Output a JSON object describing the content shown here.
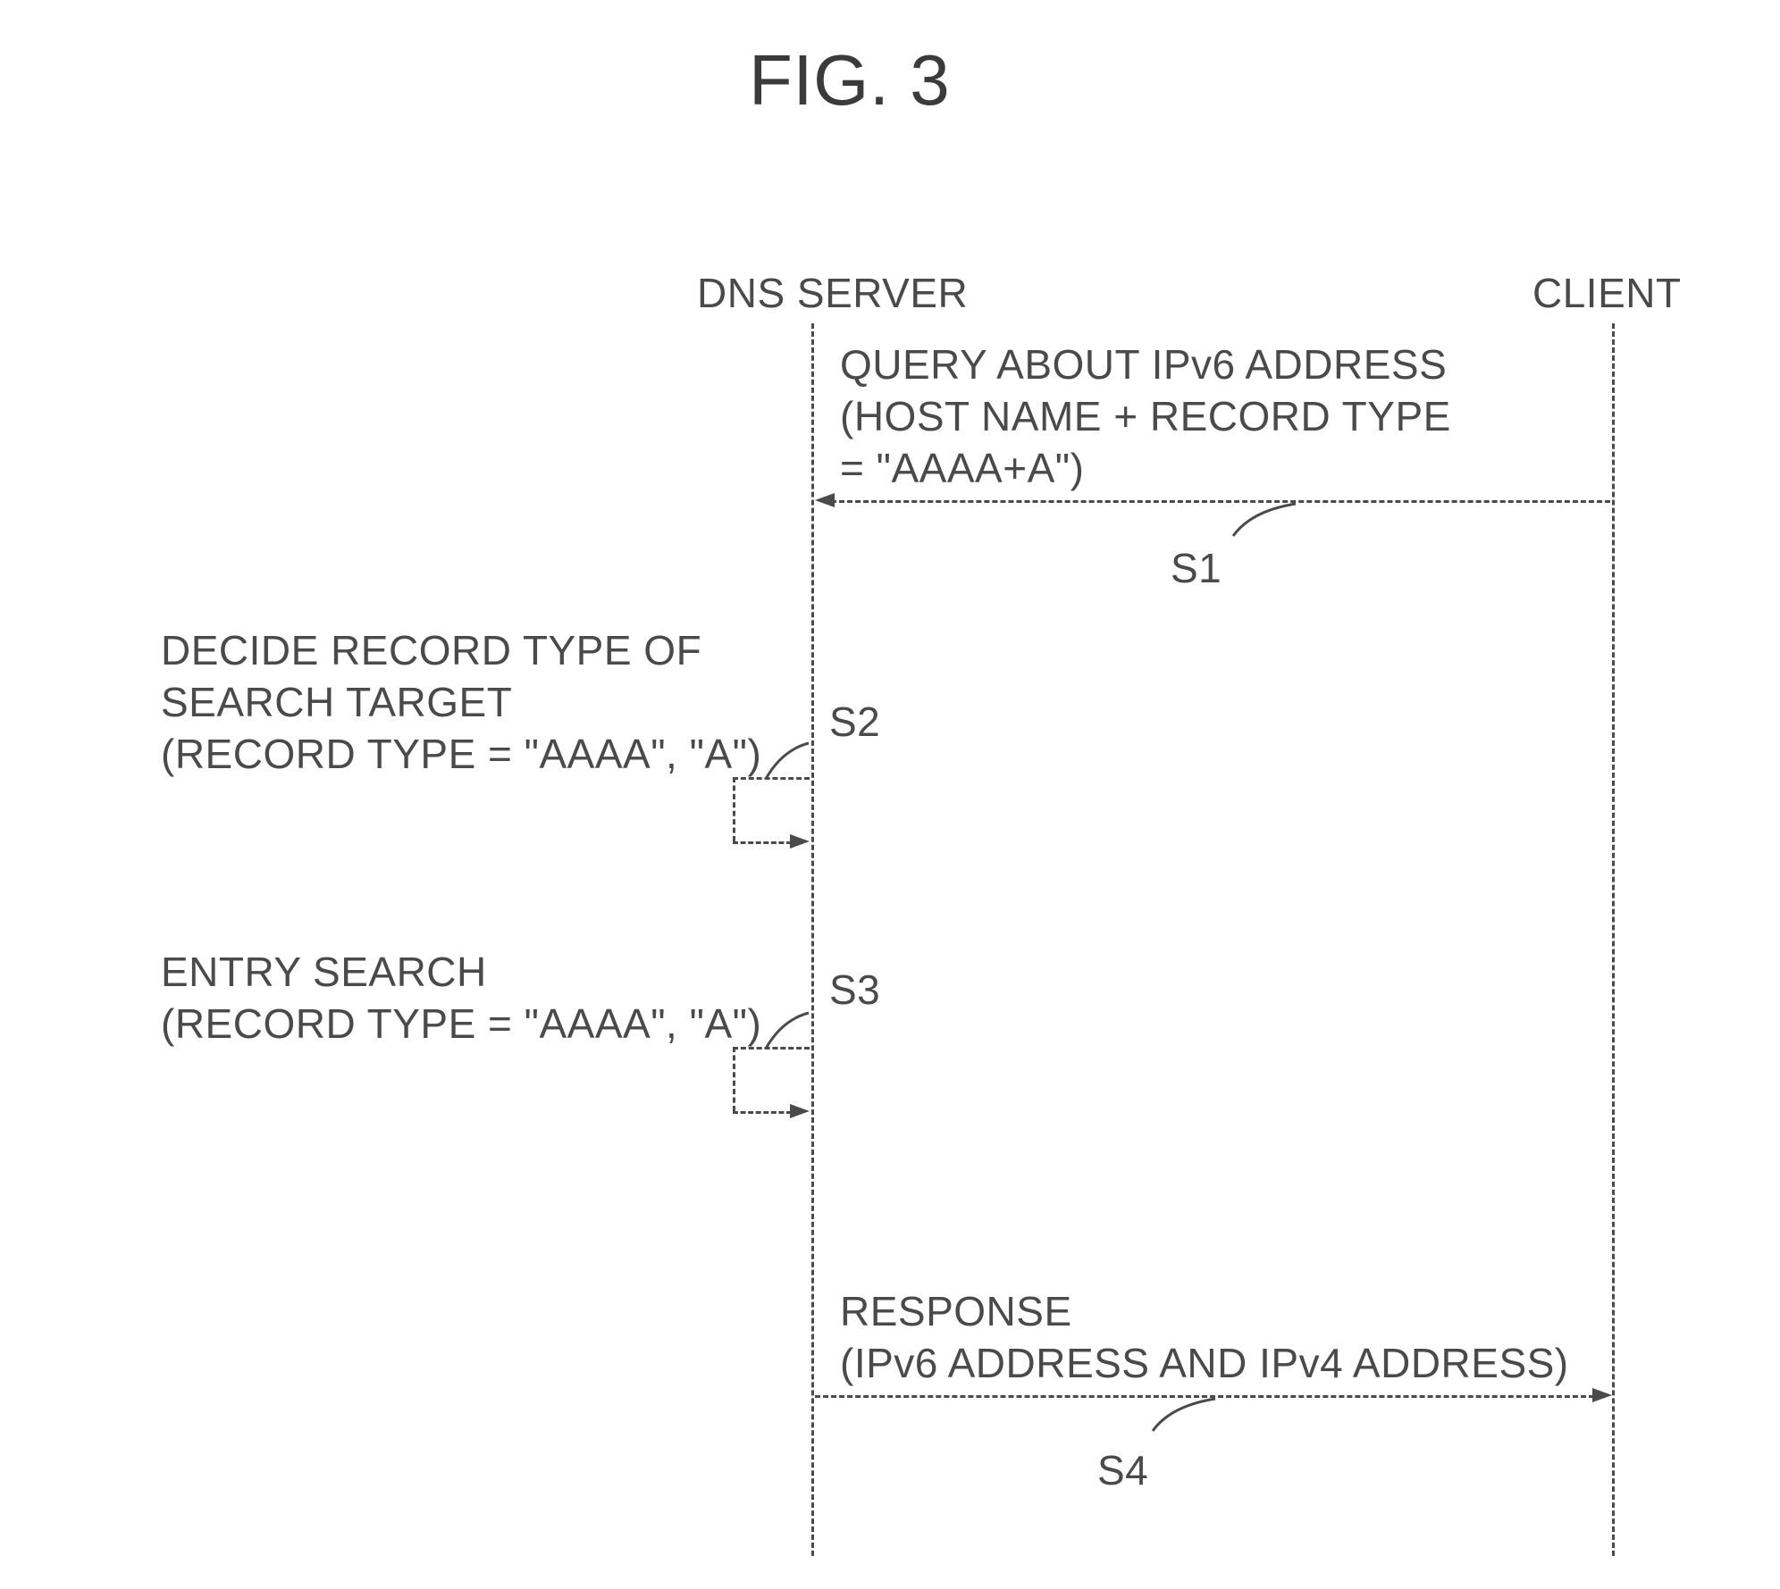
{
  "figure_title": "FIG. 3",
  "actors": {
    "server": "DNS SERVER",
    "client": "CLIENT"
  },
  "messages": {
    "s1": {
      "line1": "QUERY ABOUT IPv6 ADDRESS",
      "line2": "(HOST NAME + RECORD TYPE",
      "line3": "= \"AAAA+A\")",
      "label": "S1"
    },
    "s2": {
      "line1": "DECIDE RECORD TYPE OF",
      "line2": "SEARCH TARGET",
      "line3": "(RECORD TYPE = \"AAAA\", \"A\")",
      "label": "S2"
    },
    "s3": {
      "line1": "ENTRY SEARCH",
      "line2": "(RECORD TYPE = \"AAAA\", \"A\")",
      "label": "S3"
    },
    "s4": {
      "line1": "RESPONSE",
      "line2": "(IPv6 ADDRESS AND IPv4 ADDRESS)",
      "label": "S4"
    }
  }
}
